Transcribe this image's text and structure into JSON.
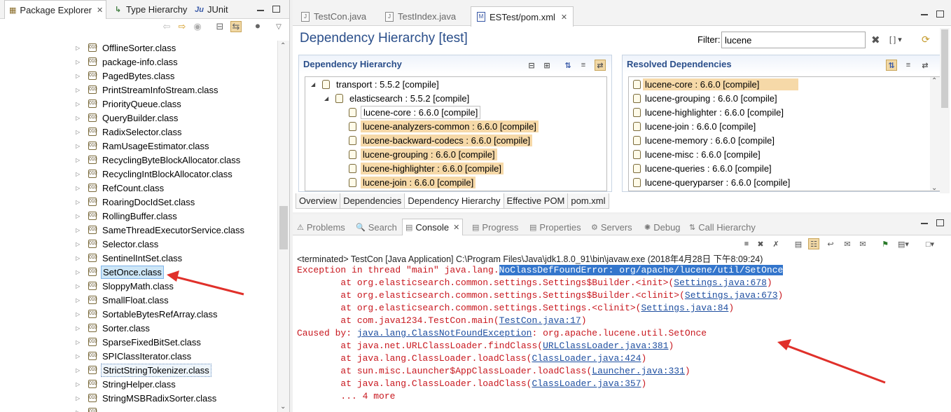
{
  "left": {
    "tabs": [
      {
        "label": "Package Explorer",
        "icon": "package-icon",
        "closable": true
      },
      {
        "label": "Type Hierarchy",
        "icon": "hierarchy-icon"
      },
      {
        "label": "JUnit",
        "icon": "junit-icon"
      }
    ],
    "classes": [
      "OfflineSorter.class",
      "package-info.class",
      "PagedBytes.class",
      "PrintStreamInfoStream.class",
      "PriorityQueue.class",
      "QueryBuilder.class",
      "RadixSelector.class",
      "RamUsageEstimator.class",
      "RecyclingByteBlockAllocator.class",
      "RecyclingIntBlockAllocator.class",
      "RefCount.class",
      "RoaringDocIdSet.class",
      "RollingBuffer.class",
      "SameThreadExecutorService.class",
      "Selector.class",
      "SentinelIntSet.class",
      "SetOnce.class",
      "SloppyMath.class",
      "SmallFloat.class",
      "SortableBytesRefArray.class",
      "Sorter.class",
      "SparseFixedBitSet.class",
      "SPIClassIterator.class",
      "StrictStringTokenizer.class",
      "StringHelper.class",
      "StringMSBRadixSorter.class"
    ],
    "selected_class": "SetOnce.class",
    "focused_class": "StrictStringTokenizer.class"
  },
  "editor": {
    "tabs": [
      {
        "label": "TestCon.java",
        "active": false
      },
      {
        "label": "TestIndex.java",
        "active": false
      },
      {
        "label": "ESTest/pom.xml",
        "active": true
      }
    ],
    "title": "Dependency Hierarchy [test]",
    "filter_label": "Filter:",
    "filter_value": "lucene",
    "hierarchy": {
      "header": "Dependency Hierarchy",
      "root": "transport : 5.5.2 [compile]",
      "child": "elasticsearch : 5.5.2 [compile]",
      "items": [
        {
          "label": "lucene-core : 6.6.0 [compile]",
          "highlight": false
        },
        {
          "label": "lucene-analyzers-common : 6.6.0 [compile]",
          "highlight": true
        },
        {
          "label": "lucene-backward-codecs : 6.6.0 [compile]",
          "highlight": true
        },
        {
          "label": "lucene-grouping : 6.6.0 [compile]",
          "highlight": true
        },
        {
          "label": "lucene-highlighter : 6.6.0 [compile]",
          "highlight": true
        },
        {
          "label": "lucene-join : 6.6.0 [compile]",
          "highlight": true
        }
      ]
    },
    "resolved": {
      "header": "Resolved Dependencies",
      "items": [
        {
          "label": "lucene-core : 6.6.0 [compile]",
          "highlight": true
        },
        {
          "label": "lucene-grouping : 6.6.0 [compile]",
          "highlight": false
        },
        {
          "label": "lucene-highlighter : 6.6.0 [compile]",
          "highlight": false
        },
        {
          "label": "lucene-join : 6.6.0 [compile]",
          "highlight": false
        },
        {
          "label": "lucene-memory : 6.6.0 [compile]",
          "highlight": false
        },
        {
          "label": "lucene-misc : 6.6.0 [compile]",
          "highlight": false
        },
        {
          "label": "lucene-queries : 6.6.0 [compile]",
          "highlight": false
        },
        {
          "label": "lucene-queryparser : 6.6.0 [compile]",
          "highlight": false
        }
      ]
    },
    "pom_tabs": [
      "Overview",
      "Dependencies",
      "Dependency Hierarchy",
      "Effective POM",
      "pom.xml"
    ],
    "active_pom_tab": "Dependency Hierarchy"
  },
  "console": {
    "tabs": [
      {
        "label": "Problems",
        "active": false
      },
      {
        "label": "Search",
        "active": false
      },
      {
        "label": "Console",
        "active": true
      },
      {
        "label": "Progress",
        "active": false
      },
      {
        "label": "Properties",
        "active": false
      },
      {
        "label": "Servers",
        "active": false
      },
      {
        "label": "Debug",
        "active": false
      },
      {
        "label": "Call Hierarchy",
        "active": false
      }
    ],
    "terminated": "<terminated> TestCon [Java Application] C:\\Program Files\\Java\\jdk1.8.0_91\\bin\\javaw.exe (2018年4月28日 下午8:09:24)",
    "lines": [
      [
        {
          "t": "Exception in thread \"main\" java.lang."
        },
        {
          "t": "NoClassDefFoundError: org/apache/lucene/util/SetOnce",
          "s": "hl"
        }
      ],
      [
        {
          "t": "        at org.elasticsearch.common.settings.Settings$Builder.<init>("
        },
        {
          "t": "Settings.java:678",
          "s": "lk"
        },
        {
          "t": ")"
        }
      ],
      [
        {
          "t": "        at org.elasticsearch.common.settings.Settings$Builder.<clinit>("
        },
        {
          "t": "Settings.java:673",
          "s": "lk"
        },
        {
          "t": ")"
        }
      ],
      [
        {
          "t": "        at org.elasticsearch.common.settings.Settings.<clinit>("
        },
        {
          "t": "Settings.java:84",
          "s": "lk"
        },
        {
          "t": ")"
        }
      ],
      [
        {
          "t": "        at com.java1234.TestCon.main("
        },
        {
          "t": "TestCon.java:17",
          "s": "lk"
        },
        {
          "t": ")"
        }
      ],
      [
        {
          "t": "Caused by: "
        },
        {
          "t": "java.lang.ClassNotFoundException",
          "s": "lk"
        },
        {
          "t": ": org.apache.lucene.util.SetOnce"
        }
      ],
      [
        {
          "t": "        at java.net.URLClassLoader.findClass("
        },
        {
          "t": "URLClassLoader.java:381",
          "s": "lk"
        },
        {
          "t": ")"
        }
      ],
      [
        {
          "t": "        at java.lang.ClassLoader.loadClass("
        },
        {
          "t": "ClassLoader.java:424",
          "s": "lk"
        },
        {
          "t": ")"
        }
      ],
      [
        {
          "t": "        at sun.misc.Launcher$AppClassLoader.loadClass("
        },
        {
          "t": "Launcher.java:331",
          "s": "lk"
        },
        {
          "t": ")"
        }
      ],
      [
        {
          "t": "        at java.lang.ClassLoader.loadClass("
        },
        {
          "t": "ClassLoader.java:357",
          "s": "lk"
        },
        {
          "t": ")"
        }
      ],
      [
        {
          "t": "        ... 4 more"
        }
      ]
    ]
  },
  "colors": {
    "error_text": "#c8171e",
    "link": "#1f4fa0",
    "highlight_dep": "#f6d9a8",
    "arrow": "#e0302a"
  }
}
